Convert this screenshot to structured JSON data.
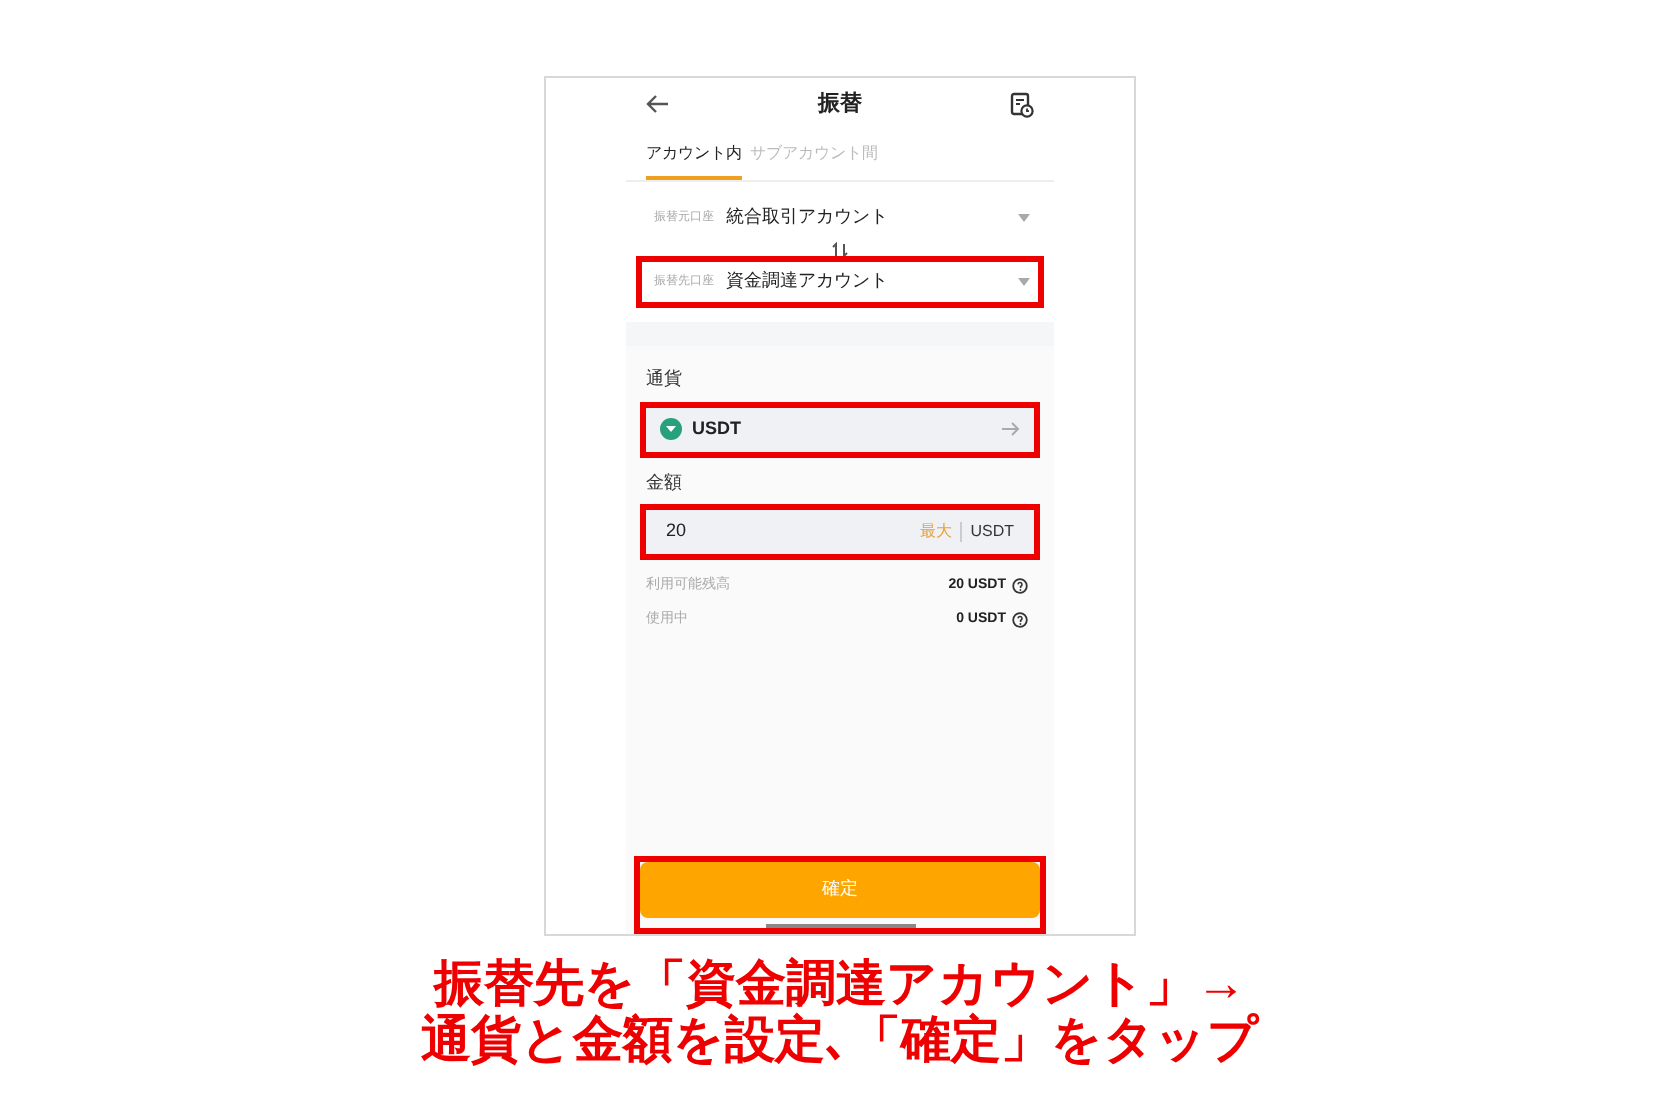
{
  "header": {
    "title": "振替"
  },
  "tabs": [
    {
      "label": "アカウント内",
      "selected": true
    },
    {
      "label": "サブアカウント間",
      "selected": false
    }
  ],
  "accounts": [
    {
      "label": "振替元口座",
      "value": "統合取引アカウント",
      "highlighted": false
    },
    {
      "label": "振替先口座",
      "value": "資金調達アカウント",
      "highlighted": true
    }
  ],
  "currency": {
    "label": "通貨",
    "value": "USDT",
    "highlighted": true
  },
  "amount": {
    "label": "金額",
    "value": "20",
    "max": "最大",
    "unit": "USDT",
    "highlighted": true
  },
  "balances": [
    {
      "label": "利用可能残高",
      "value": "20 USDT"
    },
    {
      "label": "使用中",
      "value": "0 USDT"
    }
  ],
  "confirm": {
    "label": "確定",
    "highlighted": true
  },
  "caption": [
    "振替先を「資金調達アカウント」→",
    "通貨と金額を設定､「確定」をタップ"
  ]
}
